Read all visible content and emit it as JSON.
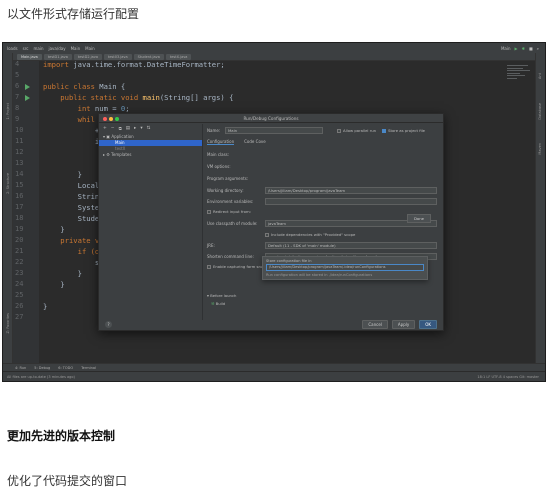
{
  "article": {
    "heading_run_config": "以文件形式存储运行配置",
    "heading_vcs": "更加先进的版本控制",
    "heading_commit": "优化了代码提交的窗口"
  },
  "ide": {
    "menu": [
      "loads",
      "src",
      "main",
      "java/day",
      "Main",
      "Main"
    ],
    "run_config_selector": "Main",
    "tabs": [
      "Main.java",
      "testD1.java",
      "testD2.java",
      "test03.java",
      "Student.java",
      "testX.java"
    ],
    "left_tools": [
      "1: Project",
      "2: Structure",
      "Z: Favorites"
    ],
    "right_tools": [
      "Ant",
      "Database",
      "Maven"
    ],
    "line_numbers": [
      "4",
      "5",
      "6",
      "7",
      "8",
      "9",
      "10",
      "11",
      "12",
      "13",
      "14",
      "15",
      "16",
      "17",
      "18",
      "19",
      "20",
      "21",
      "22",
      "23",
      "24",
      "25",
      "26",
      "27"
    ],
    "code": {
      "l4_kw": "import",
      "l4_rest": " java.time.format.DateTimeFormatter;",
      "l6_kw": "public class",
      "l6_rest": " Main {",
      "l7_kw": "    public static void ",
      "l7_fn": "main",
      "l7_rest": "(String[] args) {",
      "l8_kw": "        int",
      "l8_mid": " num = ",
      "l8_num": "0",
      "l8_end": ";",
      "l9": "        whil",
      "l10": "            +",
      "l11": "            i",
      "l14": "        }",
      "l15": "        Local",
      "l16": "        Strin",
      "l17": "        Syste",
      "l18": "        Stude",
      "l19": "    }",
      "l20_kw": "    private v",
      "l21": "        if (o",
      "l22": "            s",
      "l23": "        }",
      "l24": "    }",
      "l26": "}"
    },
    "bottom_tools": [
      "4: Run",
      "5: Debug",
      "6: TODO",
      "Terminal"
    ],
    "status_left": "All files are up-to-date (3 minutes ago)",
    "status_right": "18:1  LF  UTF-8  4 spaces  Git: master"
  },
  "dialog": {
    "title": "Run/Debug Configurations",
    "toolbar": [
      "+",
      "−",
      "⧉",
      "▤",
      "▸",
      "▾",
      "⇅"
    ],
    "tree": [
      "▾ ▣ Application",
      "Main",
      "testX",
      "▸ ⚙ Templates"
    ],
    "name_label": "Name:",
    "name_value": "Main",
    "allow_parallel": "Allow parallel run",
    "store_as_file": "Store as project file",
    "tab_config": "Configuration",
    "tab_logs": "Code Cove",
    "main_class_label": "Main class:",
    "vm_options_label": "VM options:",
    "program_args_label": "Program arguments:",
    "working_dir_label": "Working directory:",
    "working_dir_value": "/Users/jiliam/Desktop/program/javaTeam",
    "env_vars_label": "Environment variables:",
    "redirect_input": "Redirect input from:",
    "use_classpath_label": "Use classpath of module:",
    "module_value": "javaTeam",
    "include_provided": "Include dependencies with \"Provided\" scope",
    "jre_label": "JRE:",
    "jre_value": "Default (11 - SDK of 'main' module)",
    "shorten_label": "Shorten command line:",
    "shorten_value": "user-local default: none - java [options] className [args]",
    "capture_snapshots": "Enable capturing form snapshots",
    "before_launch": "Before launch",
    "build_task": "Build",
    "popup_title": "Store configuration file in",
    "popup_path": "/Users/jiliam/Desktop/program/javaTeam/.idea/runConfigurations",
    "popup_note": "Run configuration will be stored in ./idea/runConfigurations",
    "popup_button": "Done",
    "help": "?",
    "cancel": "Cancel",
    "apply": "Apply",
    "ok": "OK"
  },
  "colors": {
    "editor_bg": "#2b2b2b",
    "keyword": "#cc7832",
    "function": "#ffc66d",
    "number": "#6897bb",
    "selection": "#2f65ca",
    "primary_button": "#365880"
  }
}
